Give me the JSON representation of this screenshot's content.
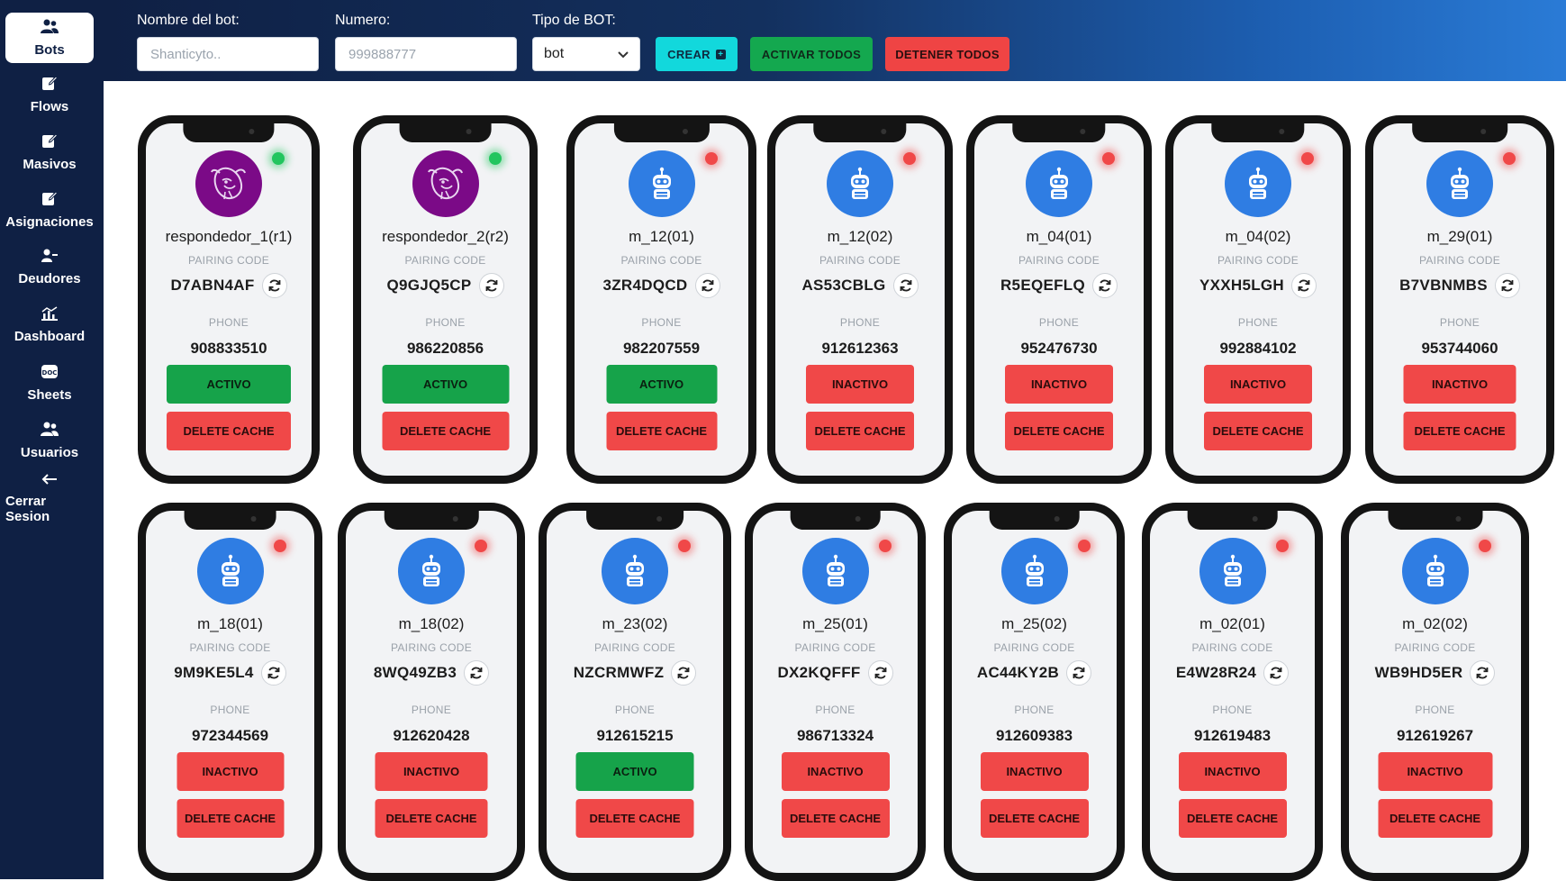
{
  "sidebar": {
    "items": [
      {
        "label": "Bots",
        "icon": "users-icon",
        "active": true
      },
      {
        "label": "Flows",
        "icon": "edit-icon"
      },
      {
        "label": "Masivos",
        "icon": "edit-icon"
      },
      {
        "label": "Asignaciones",
        "icon": "edit-icon"
      },
      {
        "label": "Deudores",
        "icon": "user-minus-icon"
      },
      {
        "label": "Dashboard",
        "icon": "chart-icon"
      },
      {
        "label": "Sheets",
        "icon": "doc-icon"
      },
      {
        "label": "Usuarios",
        "icon": "users-icon"
      },
      {
        "label": "Cerrar Sesion",
        "icon": "arrow-left-icon"
      }
    ]
  },
  "form": {
    "name_label": "Nombre del bot:",
    "name_placeholder": "Shanticyto..",
    "number_label": "Numero:",
    "number_placeholder": "999888777",
    "type_label": "Tipo de BOT:",
    "type_value": "bot",
    "create_label": "CREAR",
    "activate_all_label": "ACTIVAR TODOS",
    "stop_all_label": "DETENER TODOS"
  },
  "labels": {
    "pairing": "PAIRING CODE",
    "phone": "PHONE",
    "delete_cache": "DELETE CACHE"
  },
  "colors": {
    "sidebar": "#0f2044",
    "active_green": "#16a34a",
    "inactive_red": "#f04848",
    "robot_blue": "#2f7de3",
    "gnu_purple": "#7b0a87",
    "crear_cyan": "#12d8dc"
  },
  "bots": [
    {
      "name": "respondedor_1(r1)",
      "code": "D7ABN4AF",
      "phone": "908833510",
      "status": "ACTIVO",
      "active": true,
      "avatar": "gnu"
    },
    {
      "name": "respondedor_2(r2)",
      "code": "Q9GJQ5CP",
      "phone": "986220856",
      "status": "ACTIVO",
      "active": true,
      "avatar": "gnu"
    },
    {
      "name": "m_12(01)",
      "code": "3ZR4DQCD",
      "phone": "982207559",
      "status": "ACTIVO",
      "active": false,
      "avatar": "robot"
    },
    {
      "name": "m_12(02)",
      "code": "AS53CBLG",
      "phone": "912612363",
      "status": "INACTIVO",
      "active": false,
      "avatar": "robot"
    },
    {
      "name": "m_04(01)",
      "code": "R5EQEFLQ",
      "phone": "952476730",
      "status": "INACTIVO",
      "active": false,
      "avatar": "robot"
    },
    {
      "name": "m_04(02)",
      "code": "YXXH5LGH",
      "phone": "992884102",
      "status": "INACTIVO",
      "active": false,
      "avatar": "robot"
    },
    {
      "name": "m_29(01)",
      "code": "B7VBNMBS",
      "phone": "953744060",
      "status": "INACTIVO",
      "active": false,
      "avatar": "robot"
    },
    {
      "name": "m_18(01)",
      "code": "9M9KE5L4",
      "phone": "972344569",
      "status": "INACTIVO",
      "active": false,
      "avatar": "robot"
    },
    {
      "name": "m_18(02)",
      "code": "8WQ49ZB3",
      "phone": "912620428",
      "status": "INACTIVO",
      "active": false,
      "avatar": "robot"
    },
    {
      "name": "m_23(02)",
      "code": "NZCRMWFZ",
      "phone": "912615215",
      "status": "ACTIVO",
      "active": false,
      "avatar": "robot"
    },
    {
      "name": "m_25(01)",
      "code": "DX2KQFFF",
      "phone": "986713324",
      "status": "INACTIVO",
      "active": false,
      "avatar": "robot"
    },
    {
      "name": "m_25(02)",
      "code": "AC44KY2B",
      "phone": "912609383",
      "status": "INACTIVO",
      "active": false,
      "avatar": "robot"
    },
    {
      "name": "m_02(01)",
      "code": "E4W28R24",
      "phone": "912619483",
      "status": "INACTIVO",
      "active": false,
      "avatar": "robot"
    },
    {
      "name": "m_02(02)",
      "code": "WB9HD5ER",
      "phone": "912619267",
      "status": "INACTIVO",
      "active": false,
      "avatar": "robot"
    }
  ]
}
